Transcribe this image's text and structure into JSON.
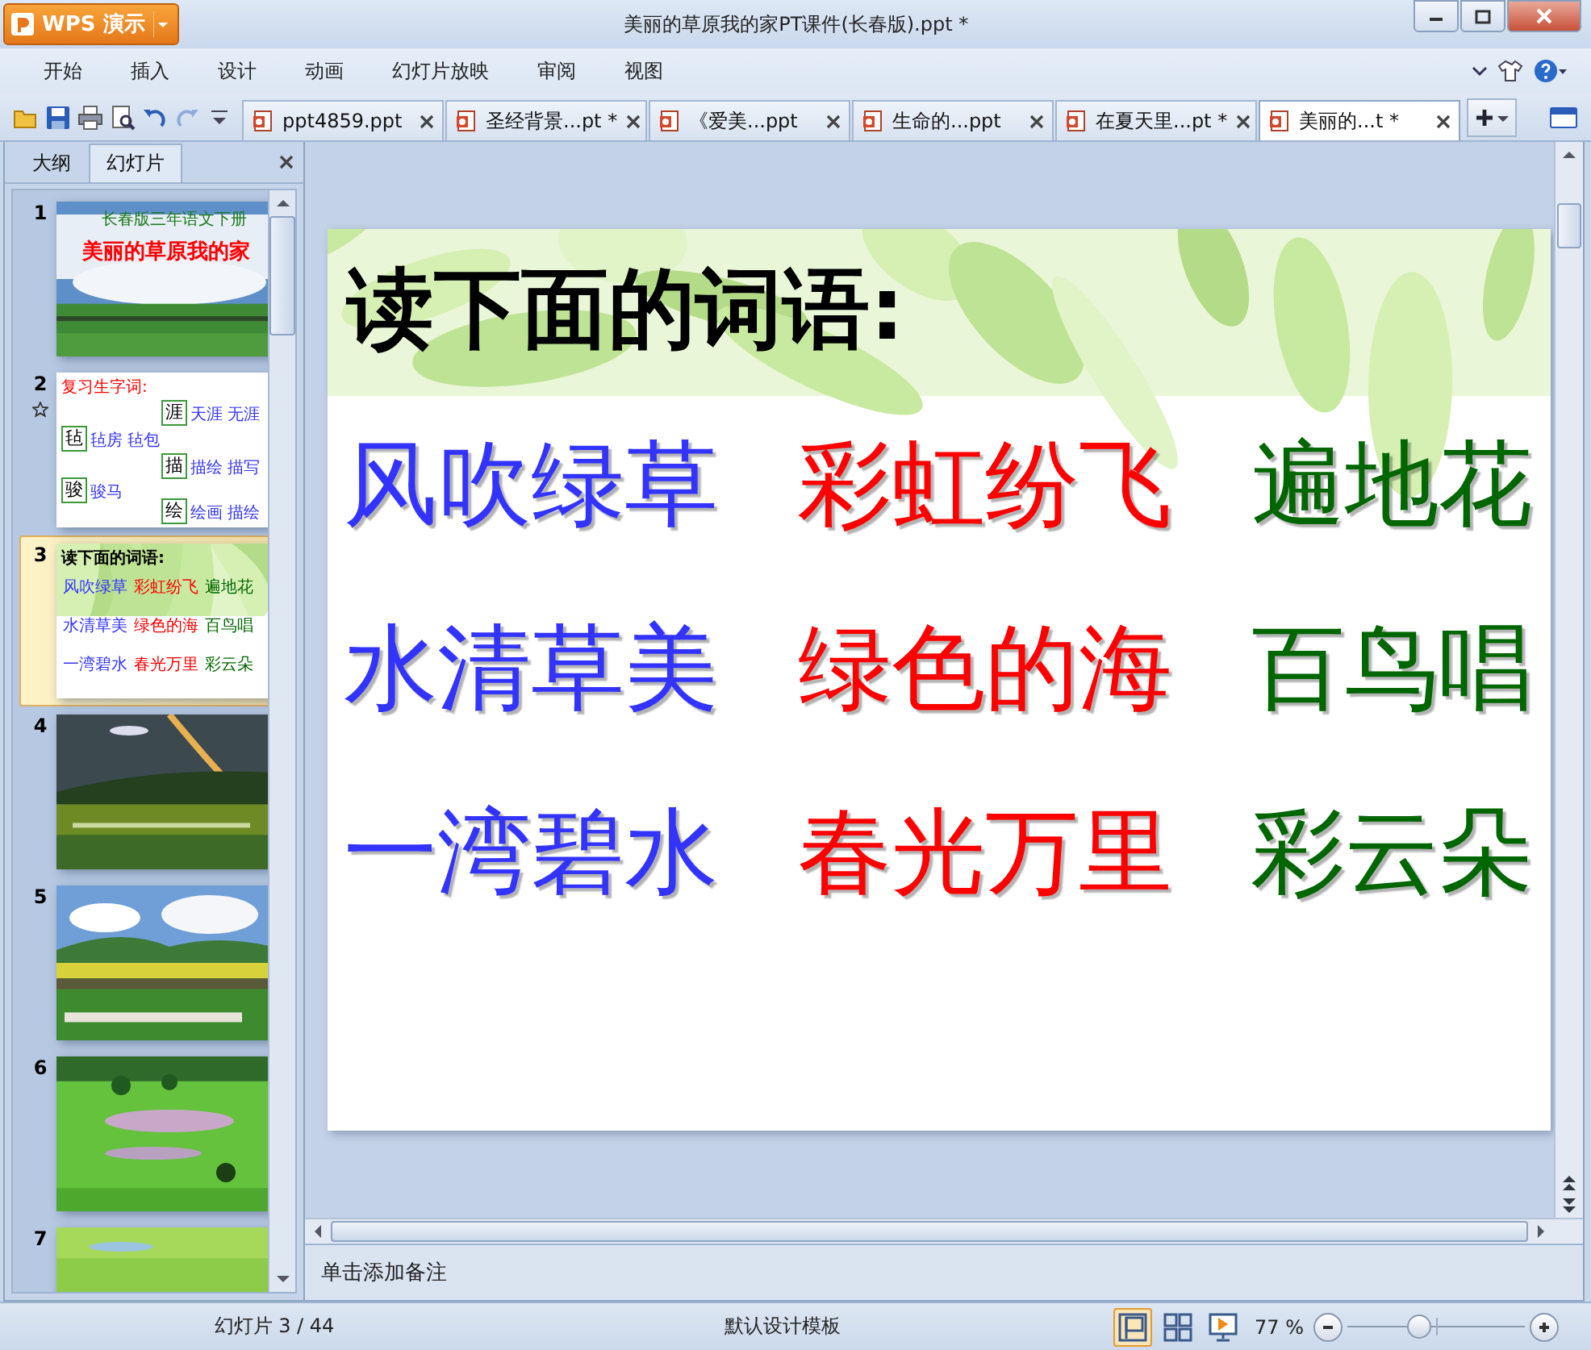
{
  "window": {
    "app_button": "WPS 演示",
    "title": "美丽的草原我的家PT课件(长春版).ppt *"
  },
  "menu": [
    {
      "label": "开始"
    },
    {
      "label": "插入"
    },
    {
      "label": "设计"
    },
    {
      "label": "动画"
    },
    {
      "label": "幻灯片放映"
    },
    {
      "label": "审阅"
    },
    {
      "label": "视图"
    }
  ],
  "toolbar": [
    {
      "kind": "open",
      "disabled": false
    },
    {
      "kind": "save",
      "disabled": false
    },
    {
      "kind": "print",
      "disabled": false
    },
    {
      "kind": "preview",
      "disabled": false
    },
    {
      "kind": "undo",
      "disabled": false
    },
    {
      "kind": "redo",
      "disabled": true
    },
    {
      "kind": "more",
      "disabled": false
    }
  ],
  "doc_tabs": [
    {
      "label": "ppt4859.ppt",
      "selected": false
    },
    {
      "label": "圣经背景...pt *",
      "selected": false
    },
    {
      "label": "《爱美...ppt",
      "selected": false
    },
    {
      "label": "生命的...ppt",
      "selected": false
    },
    {
      "label": "在夏天里...pt *",
      "selected": false
    },
    {
      "label": "美丽的...t *",
      "selected": true
    }
  ],
  "panel": {
    "tabs": [
      {
        "label": "大纲",
        "selected": false
      },
      {
        "label": "幻灯片",
        "selected": true
      }
    ],
    "thumbnails": [
      {
        "number": "1",
        "kind": "title",
        "selected": false,
        "animated": false,
        "subtitle": "长春版三年语文下册",
        "title": "美丽的草原我的家"
      },
      {
        "number": "2",
        "kind": "characters",
        "selected": false,
        "animated": true,
        "heading": "复习生字词:",
        "items": [
          {
            "char": "涯",
            "words": "天涯 无涯"
          },
          {
            "char": "毡",
            "words": "毡房 毡包"
          },
          {
            "char": "描",
            "words": "描绘 描写"
          },
          {
            "char": "骏",
            "words": "骏马"
          },
          {
            "char": "绘",
            "words": "绘画 描绘"
          }
        ]
      },
      {
        "number": "3",
        "kind": "words",
        "selected": true,
        "animated": false,
        "title": "读下面的词语:",
        "words": [
          {
            "text": "风吹绿草",
            "color": "#3333ff"
          },
          {
            "text": "彩虹纷飞",
            "color": "#ff0000"
          },
          {
            "text": "遍地花",
            "color": "#006600"
          },
          {
            "text": "水清草美",
            "color": "#3333ff"
          },
          {
            "text": "绿色的海",
            "color": "#ff0000"
          },
          {
            "text": "百鸟唱",
            "color": "#006600"
          },
          {
            "text": "一湾碧水",
            "color": "#3333ff"
          },
          {
            "text": "春光万里",
            "color": "#ff0000"
          },
          {
            "text": "彩云朵",
            "color": "#006600"
          }
        ]
      },
      {
        "number": "4",
        "kind": "picture",
        "selected": false,
        "animated": false
      },
      {
        "number": "5",
        "kind": "picture",
        "selected": false,
        "animated": false
      },
      {
        "number": "6",
        "kind": "picture",
        "selected": false,
        "animated": false
      },
      {
        "number": "7",
        "kind": "picture",
        "selected": false,
        "animated": false
      }
    ]
  },
  "slide": {
    "title": "读下面的词语:",
    "words": [
      {
        "text": "风吹绿草",
        "color": "#3333ff"
      },
      {
        "text": "彩虹纷飞",
        "color": "#ff0000"
      },
      {
        "text": "遍地花",
        "color": "#006600"
      },
      {
        "text": "水清草美",
        "color": "#3333ff"
      },
      {
        "text": "绿色的海",
        "color": "#ff0000"
      },
      {
        "text": "百鸟唱",
        "color": "#006600"
      },
      {
        "text": "一湾碧水",
        "color": "#3333ff"
      },
      {
        "text": "春光万里",
        "color": "#ff0000"
      },
      {
        "text": "彩云朵",
        "color": "#006600"
      }
    ]
  },
  "notes": {
    "placeholder": "单击添加备注"
  },
  "status_bar": {
    "slide_counter": "幻灯片 3 / 44",
    "template": "默认设计模板",
    "views": [
      {
        "kind": "normal",
        "selected": true
      },
      {
        "kind": "sorter",
        "selected": false
      },
      {
        "kind": "show",
        "selected": false
      }
    ],
    "zoom": {
      "reading": "77 %",
      "level": 0.4
    }
  }
}
